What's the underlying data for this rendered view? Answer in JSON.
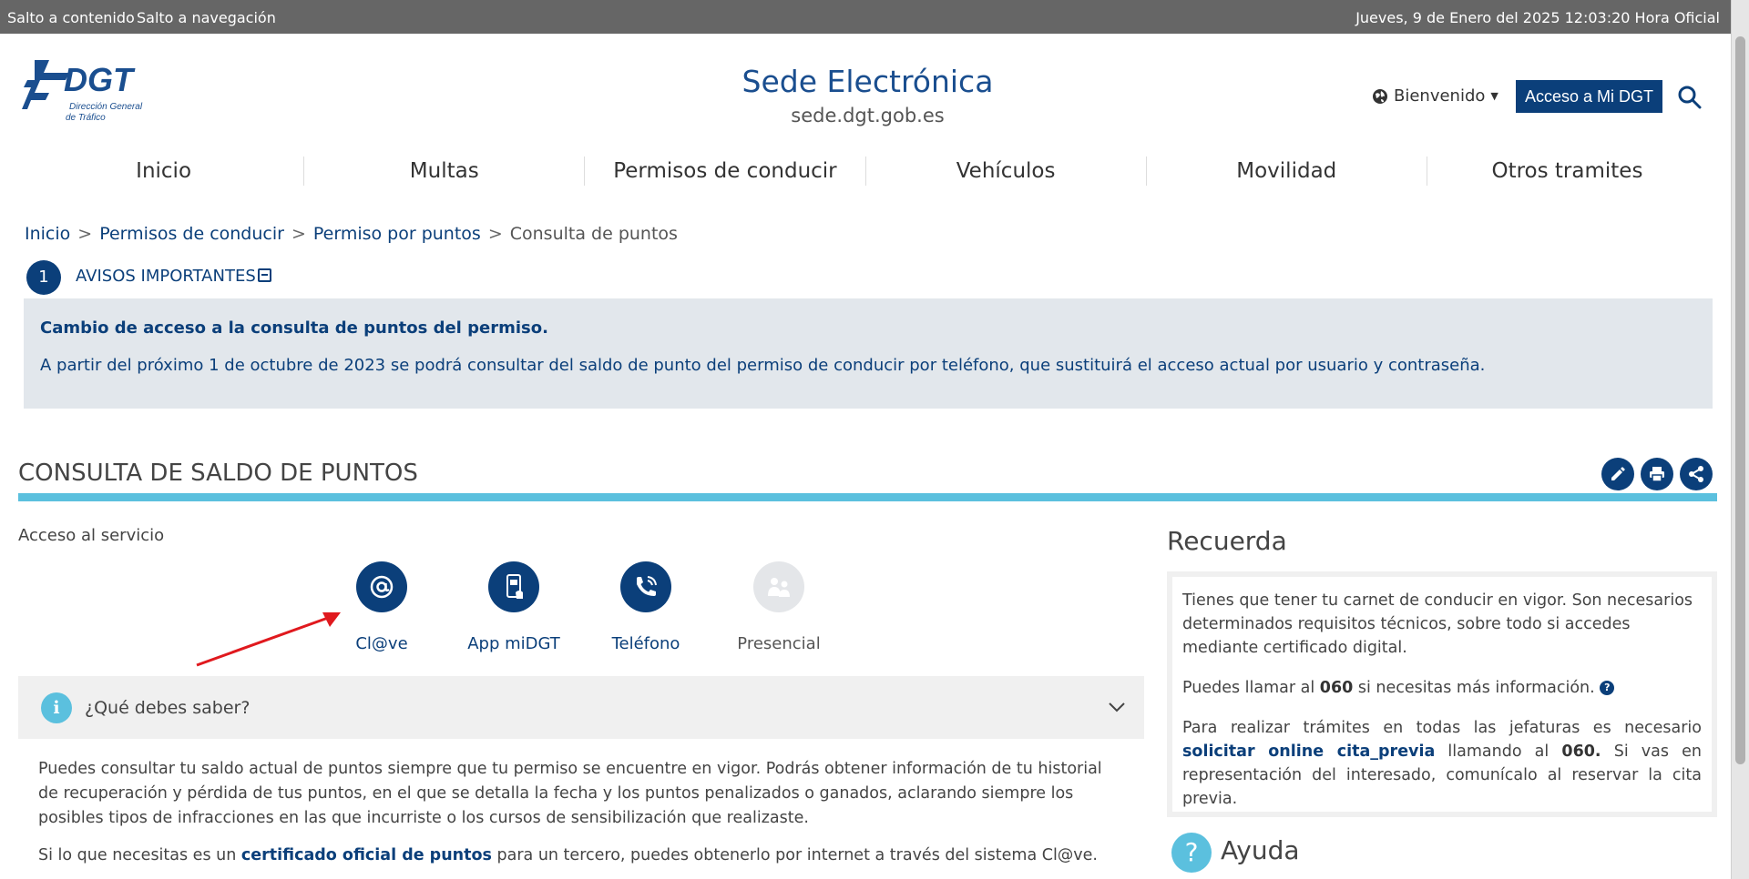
{
  "topbar": {
    "skip_content": "Salto a contenido",
    "skip_nav": "Salto a navegación",
    "datetime": "Jueves, 9 de Enero del 2025 12:03:20 Hora Oficial"
  },
  "header": {
    "logo_text": "DGT",
    "logo_sub1": "Dirección General",
    "logo_sub2": "de Tráfico",
    "title": "Sede Electrónica",
    "domain": "sede.dgt.gob.es",
    "welcome": "Bienvenido",
    "midgt_button": "Acceso a Mi DGT"
  },
  "nav": {
    "items": [
      "Inicio",
      "Multas",
      "Permisos de conducir",
      "Vehículos",
      "Movilidad",
      "Otros tramites"
    ]
  },
  "breadcrumb": {
    "items": [
      "Inicio",
      "Permisos de conducir",
      "Permiso por puntos"
    ],
    "current": "Consulta de puntos",
    "separator": ">"
  },
  "avisos": {
    "count": "1",
    "title": "AVISOS IMPORTANTES",
    "heading": "Cambio de acceso a la consulta de puntos del permiso.",
    "body": "A partir del próximo 1 de octubre de 2023 se podrá consultar del saldo de punto del permiso de conducir por teléfono, que sustituirá el acceso actual por usuario y contraseña."
  },
  "section": {
    "title": "CONSULTA DE SALDO DE PUNTOS",
    "acceso_label": "Acceso al servicio",
    "channels": [
      {
        "label": "Cl@ve",
        "icon": "clave-at-icon",
        "enabled": true
      },
      {
        "label": "App miDGT",
        "icon": "mobile-app-icon",
        "enabled": true
      },
      {
        "label": "Teléfono",
        "icon": "phone-icon",
        "enabled": true
      },
      {
        "label": "Presencial",
        "icon": "in-person-icon",
        "enabled": false
      }
    ]
  },
  "accordion": {
    "title": "¿Qué debes saber?",
    "text1": "Puedes consultar tu saldo actual de puntos siempre que tu permiso se encuentre en vigor. Podrás obtener información de tu historial de recuperación y pérdida de tus puntos, en el que se detalla la fecha y los puntos penalizados o ganados, aclarando siempre los posibles tipos de infracciones en las que incurriste o los cursos de sensibilización que realizaste.",
    "text2_pre": "Si lo que necesitas es un ",
    "text2_link": "certificado oficial de puntos",
    "text2_post": " para un tercero, puedes obtenerlo por internet a través del sistema Cl@ve."
  },
  "recuerda": {
    "title": "Recuerda",
    "p1": "Tienes que tener tu carnet de conducir en vigor. Son necesarios determinados requisitos técnicos, sobre todo si accedes mediante certificado digital.",
    "p2_pre": "Puedes llamar al ",
    "p2_num": "060",
    "p2_post": " si necesitas más información. ",
    "p3_pre": "Para realizar trámites en todas las jefaturas es necesario ",
    "p3_link": "solicitar online cita_previa",
    "p3_mid": " llamando al ",
    "p3_num": "060.",
    "p3_post": " Si vas en representación del interesado, comunícalo al reservar la cita previa."
  },
  "ayuda": {
    "title": "Ayuda"
  },
  "colors": {
    "primary": "#0b3f7a",
    "accent": "#5bc0de",
    "notice_bg": "#e2e7ec"
  }
}
